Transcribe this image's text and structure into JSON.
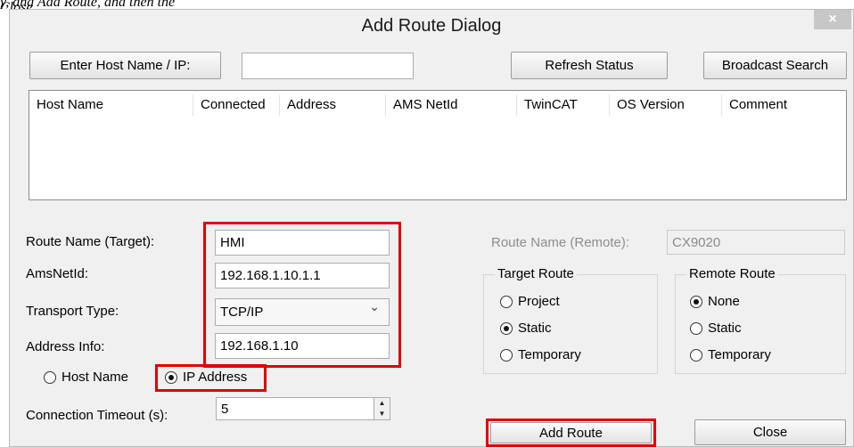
{
  "caption_fragment": "y, and Add Route, and then the Close.",
  "dialog": {
    "title": "Add Route Dialog",
    "close_glyph": "×"
  },
  "search": {
    "enter_host_label": "Enter Host Name / IP:",
    "host_value": "",
    "refresh_label": "Refresh Status",
    "broadcast_label": "Broadcast Search"
  },
  "table": {
    "columns": [
      "Host Name",
      "Connected",
      "Address",
      "AMS NetId",
      "TwinCAT",
      "OS Version",
      "Comment"
    ],
    "rows": []
  },
  "form": {
    "route_name_label": "Route Name (Target):",
    "route_name_value": "HMI",
    "ams_label": "AmsNetId:",
    "ams_value": "192.168.1.10.1.1",
    "transport_label": "Transport Type:",
    "transport_value": "TCP/IP",
    "address_label": "Address Info:",
    "address_value": "192.168.1.10",
    "host_name_option": "Host Name",
    "ip_address_option": "IP Address",
    "address_mode": "IP Address",
    "timeout_label": "Connection Timeout (s):",
    "timeout_value": "5"
  },
  "remote": {
    "route_name_remote_label": "Route Name (Remote):",
    "route_name_remote_value": "CX9020"
  },
  "target_route": {
    "title": "Target Route",
    "options": [
      "Project",
      "Static",
      "Temporary"
    ],
    "selected": "Static"
  },
  "remote_route": {
    "title": "Remote Route",
    "options": [
      "None",
      "Static",
      "Temporary"
    ],
    "selected": "None"
  },
  "actions": {
    "add_route_label": "Add Route",
    "close_label": "Close"
  },
  "colors": {
    "highlight": "#e00000",
    "dialog_bg": "#f0f0f0"
  }
}
